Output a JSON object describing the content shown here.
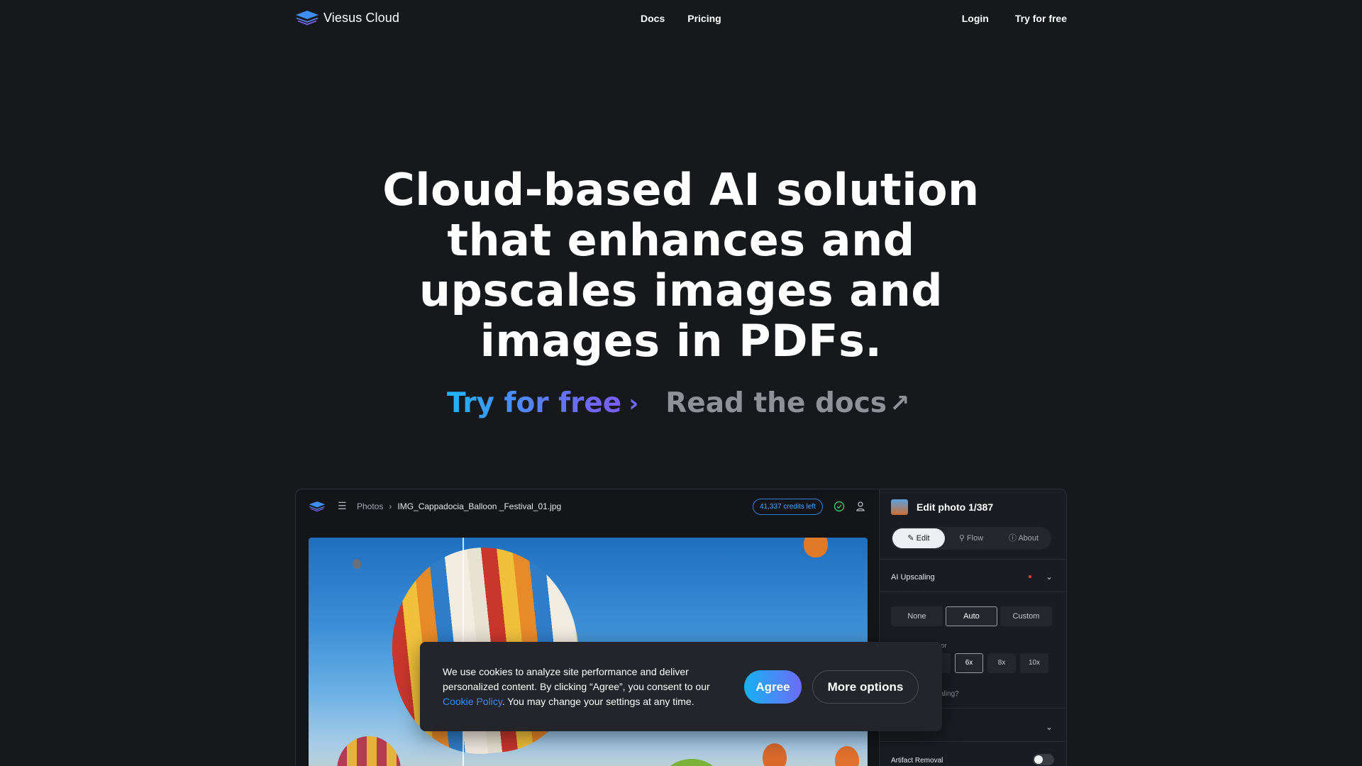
{
  "nav": {
    "brand": "Viesus Cloud",
    "links": [
      "Docs",
      "Pricing"
    ],
    "login": "Login",
    "try": "Try for free"
  },
  "hero": {
    "lines": [
      "Cloud-based AI solution",
      "that enhances and",
      "upscales images and",
      "images in PDFs."
    ],
    "cta_try": "Try for free",
    "cta_docs": "Read the docs"
  },
  "app": {
    "crumb_root": "Photos",
    "file": "IMG_Cappadocia_Balloon _Festival_01.jpg",
    "credits": "41,337 credits left",
    "panel_title": "Edit photo 1/387",
    "tabs": [
      "Edit",
      "Flow",
      "About"
    ],
    "section_upscaling": "AI Upscaling",
    "modes": [
      "None",
      "Auto",
      "Custom"
    ],
    "factor_label_partial": "factor",
    "factors": [
      "x",
      "6x",
      "8x",
      "10x"
    ],
    "scaling_partial": "caling?",
    "artifact_removal": "Artifact Removal"
  },
  "cookie": {
    "text_a": "We use cookies to analyze site performance and deliver personalized content. By clicking “Agree”, you consent to our ",
    "link": "Cookie Policy",
    "text_b": ". You may change your settings at any time.",
    "agree": "Agree",
    "more": "More options"
  },
  "colors": {
    "background": "#17181c",
    "accent_start": "#1fb4f5",
    "accent_end": "#7a5cf5",
    "link": "#3b8bff"
  }
}
